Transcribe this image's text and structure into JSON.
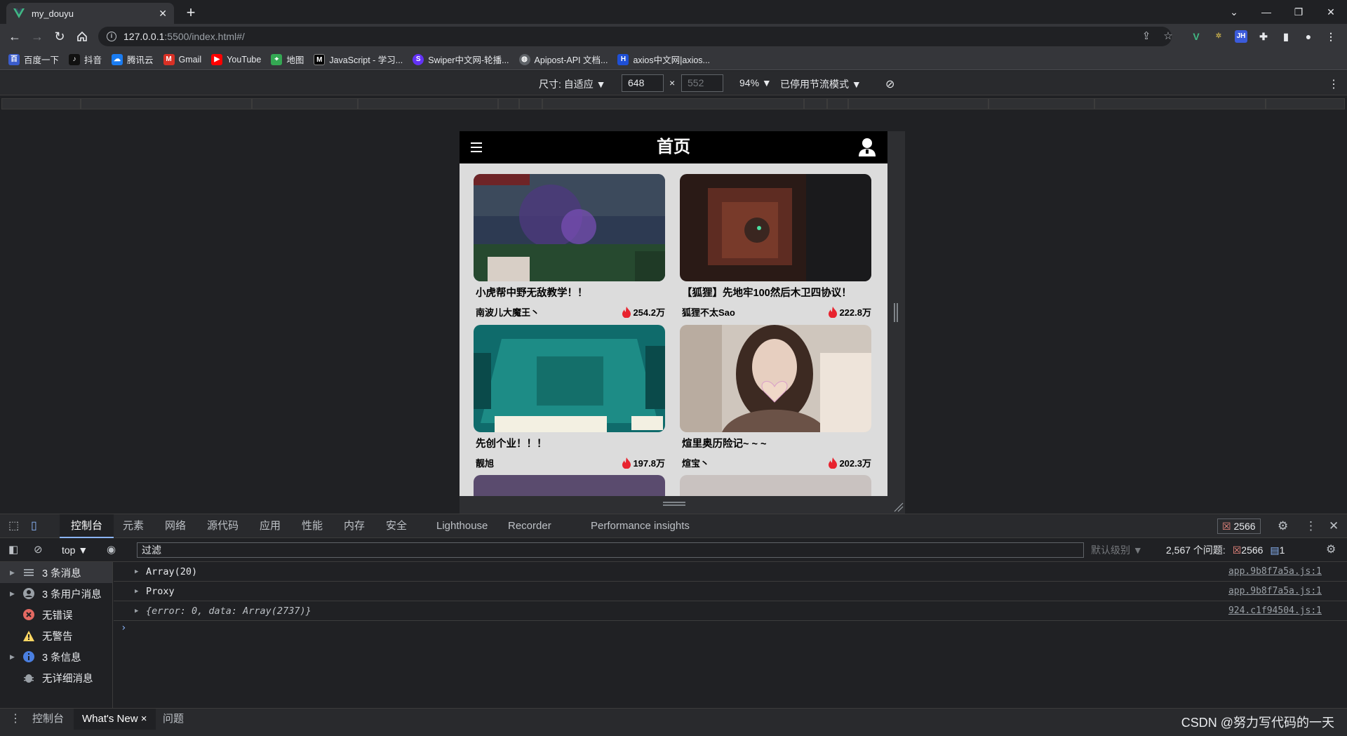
{
  "browser": {
    "tab_title": "my_douyu",
    "new_tab": "+",
    "url_host": "127.0.0.1",
    "url_rest": ":5500/index.html#/",
    "bookmarks": [
      {
        "label": "百度一下",
        "icon": "baidu-icon",
        "color": "#3a5ccc"
      },
      {
        "label": "抖音",
        "icon": "douyin-icon",
        "color": "#111111"
      },
      {
        "label": "腾讯云",
        "icon": "tencent-cloud-icon",
        "color": "#1a7cf1"
      },
      {
        "label": "Gmail",
        "icon": "gmail-icon",
        "color": "#d93025"
      },
      {
        "label": "YouTube",
        "icon": "youtube-icon",
        "color": "#ff0000"
      },
      {
        "label": "地图",
        "icon": "maps-icon",
        "color": "#34a853"
      },
      {
        "label": "JavaScript - 学习...",
        "icon": "mdn-icon",
        "color": "#000000"
      },
      {
        "label": "Swiper中文网-轮播...",
        "icon": "swiper-icon",
        "color": "#6332f6"
      },
      {
        "label": "Apipost-API 文档...",
        "icon": "globe-icon",
        "color": "#5f6368"
      },
      {
        "label": "axios中文网|axios...",
        "icon": "axios-icon",
        "color": "#1e4fd6"
      }
    ]
  },
  "device_toolbar": {
    "size_label": "尺寸: 自适应 ▼",
    "width": "648",
    "times": "×",
    "height": "552",
    "zoom": "94% ▼",
    "throttle": "已停用节流模式 ▼"
  },
  "app": {
    "title": "首页",
    "cards": [
      {
        "title": "小虎帮中野无敌教学！！",
        "author": "南波儿大魔王丶",
        "hot": "254.2万",
        "thumb_colors": [
          "#2d3a52",
          "#4b3a7a",
          "#26492f"
        ]
      },
      {
        "title": "【狐狸】先地牢100然后木卫四协议！",
        "author": "狐狸不太Sao",
        "hot": "222.8万",
        "thumb_colors": [
          "#2a1a16",
          "#6b3125",
          "#1a1a1c"
        ]
      },
      {
        "title": "先创个业！！！",
        "author": "靓旭",
        "hot": "197.8万",
        "thumb_colors": [
          "#0f6b6b",
          "#1d8c86",
          "#f3f0e2"
        ]
      },
      {
        "title": "煊里奥历险记~ ~ ~",
        "author": "煊宝丶",
        "hot": "202.3万",
        "thumb_colors": [
          "#cfc6bd",
          "#6b5247",
          "#eee4da"
        ]
      }
    ],
    "partial_colors": [
      "#5a4b6e",
      "#c9c2c0"
    ]
  },
  "devtools": {
    "tabs": [
      "控制台",
      "元素",
      "网络",
      "源代码",
      "应用",
      "性能",
      "内存",
      "安全",
      "Lighthouse",
      "Recorder",
      "Performance insights"
    ],
    "error_badge": "2566",
    "context": "top ▼",
    "filter_placeholder": "过滤",
    "level": "默认级别 ▼",
    "issues_label": "2,567 个问题:",
    "issues_errors": "2566",
    "issues_info": "1",
    "sidebar": [
      {
        "label": "3 条消息",
        "icon": "list-icon",
        "expandable": true
      },
      {
        "label": "3 条用户消息",
        "icon": "user-icon",
        "expandable": true
      },
      {
        "label": "无错误",
        "icon": "error-icon",
        "expandable": false
      },
      {
        "label": "无警告",
        "icon": "warning-icon",
        "expandable": false
      },
      {
        "label": "3 条信息",
        "icon": "info-icon",
        "expandable": true
      },
      {
        "label": "无详细消息",
        "icon": "bug-icon",
        "expandable": false
      }
    ],
    "logs": [
      {
        "text": "Array(20)",
        "source": "app.9b8f7a5a.js:1"
      },
      {
        "text": "Proxy",
        "source": "app.9b8f7a5a.js:1"
      },
      {
        "text": "{error: 0, data: Array(2737)}",
        "source": "924.c1f94504.js:1"
      }
    ],
    "prompt": "›",
    "drawer_tabs": [
      "控制台",
      "What's New",
      "问题"
    ],
    "drawer_close": "×"
  },
  "watermark": "CSDN @努力写代码的一天",
  "colors": {
    "flame": "#e8232e",
    "accent": "#8ab4f8"
  }
}
